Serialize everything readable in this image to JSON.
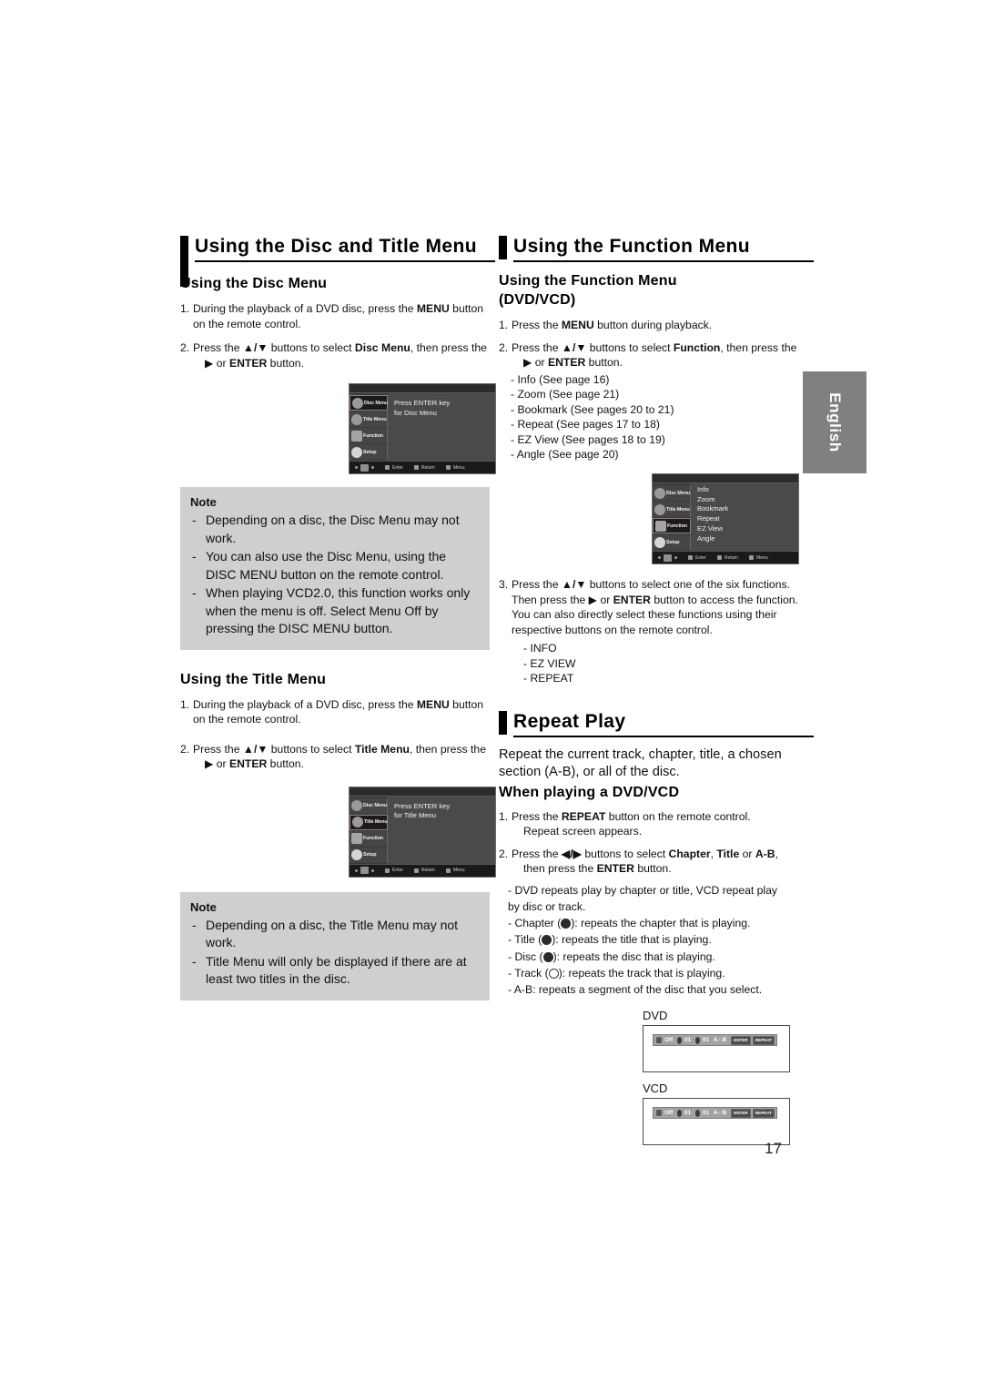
{
  "page": {
    "number": "17",
    "language_tab": "English"
  },
  "left_column": {
    "section_title": "Using the Disc and Title Menu",
    "disc_menu": {
      "heading": "Using the Disc Menu",
      "step1_num": "1.",
      "step1_a": "During the playback of a DVD disc, press the ",
      "step1_bold": "MENU",
      "step1_b": " button on the remote control.",
      "step2_num": "2.",
      "step2_a": "Press the ",
      "step2_arrows": "▲/▼",
      "step2_b": " buttons to select ",
      "step2_bold": "Disc Menu",
      "step2_c": ", then press the",
      "step2_line2_a": "▶ or ",
      "step2_line2_bold": "ENTER",
      "step2_line2_b": " button."
    },
    "disc_screen": {
      "menu_items": [
        "Disc Menu",
        "Title Menu",
        "Function",
        "Setup"
      ],
      "message_line1": "Press ENTER key",
      "message_line2": "for Disc Menu",
      "bottom_bar": [
        "Enter",
        "Return",
        "Menu"
      ]
    },
    "note1": {
      "title": "Note",
      "items": [
        "Depending on a disc, the Disc Menu may not work.",
        "You can also use the Disc Menu, using the DISC MENU button on the remote control.",
        "When playing VCD2.0, this function works only when the menu is off. Select Menu Off by pressing the DISC MENU button."
      ]
    },
    "title_menu": {
      "heading": "Using the Title Menu",
      "step1_num": "1.",
      "step1_a": "During the playback of a DVD disc, press the ",
      "step1_bold": "MENU",
      "step1_b": " button on the remote control.",
      "step2_num": "2.",
      "step2_a": "Press the ",
      "step2_arrows": "▲/▼",
      "step2_b": " buttons to select ",
      "step2_bold": "Title Menu",
      "step2_c": ", then press the",
      "step2_line2_a": "▶ or ",
      "step2_line2_bold": "ENTER",
      "step2_line2_b": " button."
    },
    "title_screen": {
      "menu_items": [
        "Disc Menu",
        "Title Menu",
        "Function",
        "Setup"
      ],
      "message_line1": "Press ENTER key",
      "message_line2": "for Title Menu",
      "bottom_bar": [
        "Enter",
        "Return",
        "Menu"
      ]
    },
    "note2": {
      "title": "Note",
      "items": [
        "Depending on a disc, the Title Menu may not work.",
        "Title Menu will only be displayed if there are at least two titles in the disc."
      ]
    }
  },
  "right_column": {
    "section_title": "Using the Function Menu",
    "function_menu": {
      "heading_line1": "Using the Function Menu",
      "heading_line2": "(DVD/VCD)",
      "step1_num": "1.",
      "step1_a": "Press the ",
      "step1_bold": "MENU",
      "step1_b": " button during playback.",
      "step2_num": "2.",
      "step2_a": "Press the ",
      "step2_arrows": "▲/▼",
      "step2_b": " buttons to select ",
      "step2_bold": "Function",
      "step2_c": ", then press the",
      "step2_line2_a": "▶ or ",
      "step2_line2_bold": "ENTER",
      "step2_line2_b": " button.",
      "function_list": [
        "- Info (See page 16)",
        "- Zoom (See page 21)",
        "- Bookmark (See pages 20 to 21)",
        "- Repeat (See pages 17 to 18)",
        "- EZ View (See pages 18 to 19)",
        "- Angle (See page 20)"
      ]
    },
    "function_screen": {
      "menu_items": [
        "Disc Menu",
        "Title Menu",
        "Function",
        "Setup"
      ],
      "options": [
        "Info",
        "Zoom",
        "Bookmark",
        "Repeat",
        "EZ View",
        "Angle"
      ],
      "bottom_bar": [
        "Enter",
        "Return",
        "Menu"
      ]
    },
    "step3": {
      "num": "3.",
      "line1_a": "Press the ",
      "line1_arrows": "▲/▼",
      "line1_b": " buttons to select one of the six functions.",
      "line2_a": "Then press the ▶ or ",
      "line2_bold": "ENTER",
      "line2_b": " button to access the function.",
      "line3": "You can also directly select these functions using their",
      "line4": "respective buttons on the remote control.",
      "remote_list": [
        "- INFO",
        "- EZ VIEW",
        "- REPEAT"
      ]
    },
    "repeat_play": {
      "section_title": "Repeat Play",
      "intro_line1": "Repeat the current track, chapter, title, a chosen",
      "intro_line2": "section (A-B), or all of the disc.",
      "heading": "When playing a DVD/VCD",
      "step1_num": "1.",
      "step1_a": "Press the ",
      "step1_bold": "REPEAT",
      "step1_b": " button on the remote control.",
      "step1_line2": "Repeat screen appears.",
      "step2_num": "2.",
      "step2_a": "Press the ",
      "step2_arrows": "◀/▶",
      "step2_b": " buttons to select ",
      "step2_bold1": "Chapter",
      "step2_c": ", ",
      "step2_bold2": "Title",
      "step2_d": " or ",
      "step2_bold3": "A-B",
      "step2_e": ",",
      "step2_line2_a": "then press the ",
      "step2_line2_bold": "ENTER",
      "step2_line2_b": " button.",
      "bullets": {
        "b1_line1": "- DVD repeats play by chapter or title, VCD repeat play",
        "b1_line2": " by disc or track.",
        "chapter_pre": "- Chapter (",
        "chapter_post": "): repeats the chapter that is playing.",
        "title_pre": "- Title (",
        "title_post": "): repeats the title that is playing.",
        "disc_pre": "- Disc (",
        "disc_post": "): repeats the disc that is playing.",
        "track_pre": "- Track (",
        "track_post": "): repeats the track that is playing.",
        "ab": "- A-B: repeats a segment of the disc that you select."
      },
      "osd_dvd": {
        "label": "DVD",
        "off": "Off",
        "chapter_num": "01",
        "title_num": "01",
        "ab": "A - B",
        "key_enter": "ENTER",
        "key_repeat": "REPEAT"
      },
      "osd_vcd": {
        "label": "VCD",
        "off": "Off",
        "track_num": "01",
        "disc_num": "01",
        "ab": "A - B",
        "key_enter": "ENTER",
        "key_repeat": "REPEAT"
      }
    }
  }
}
